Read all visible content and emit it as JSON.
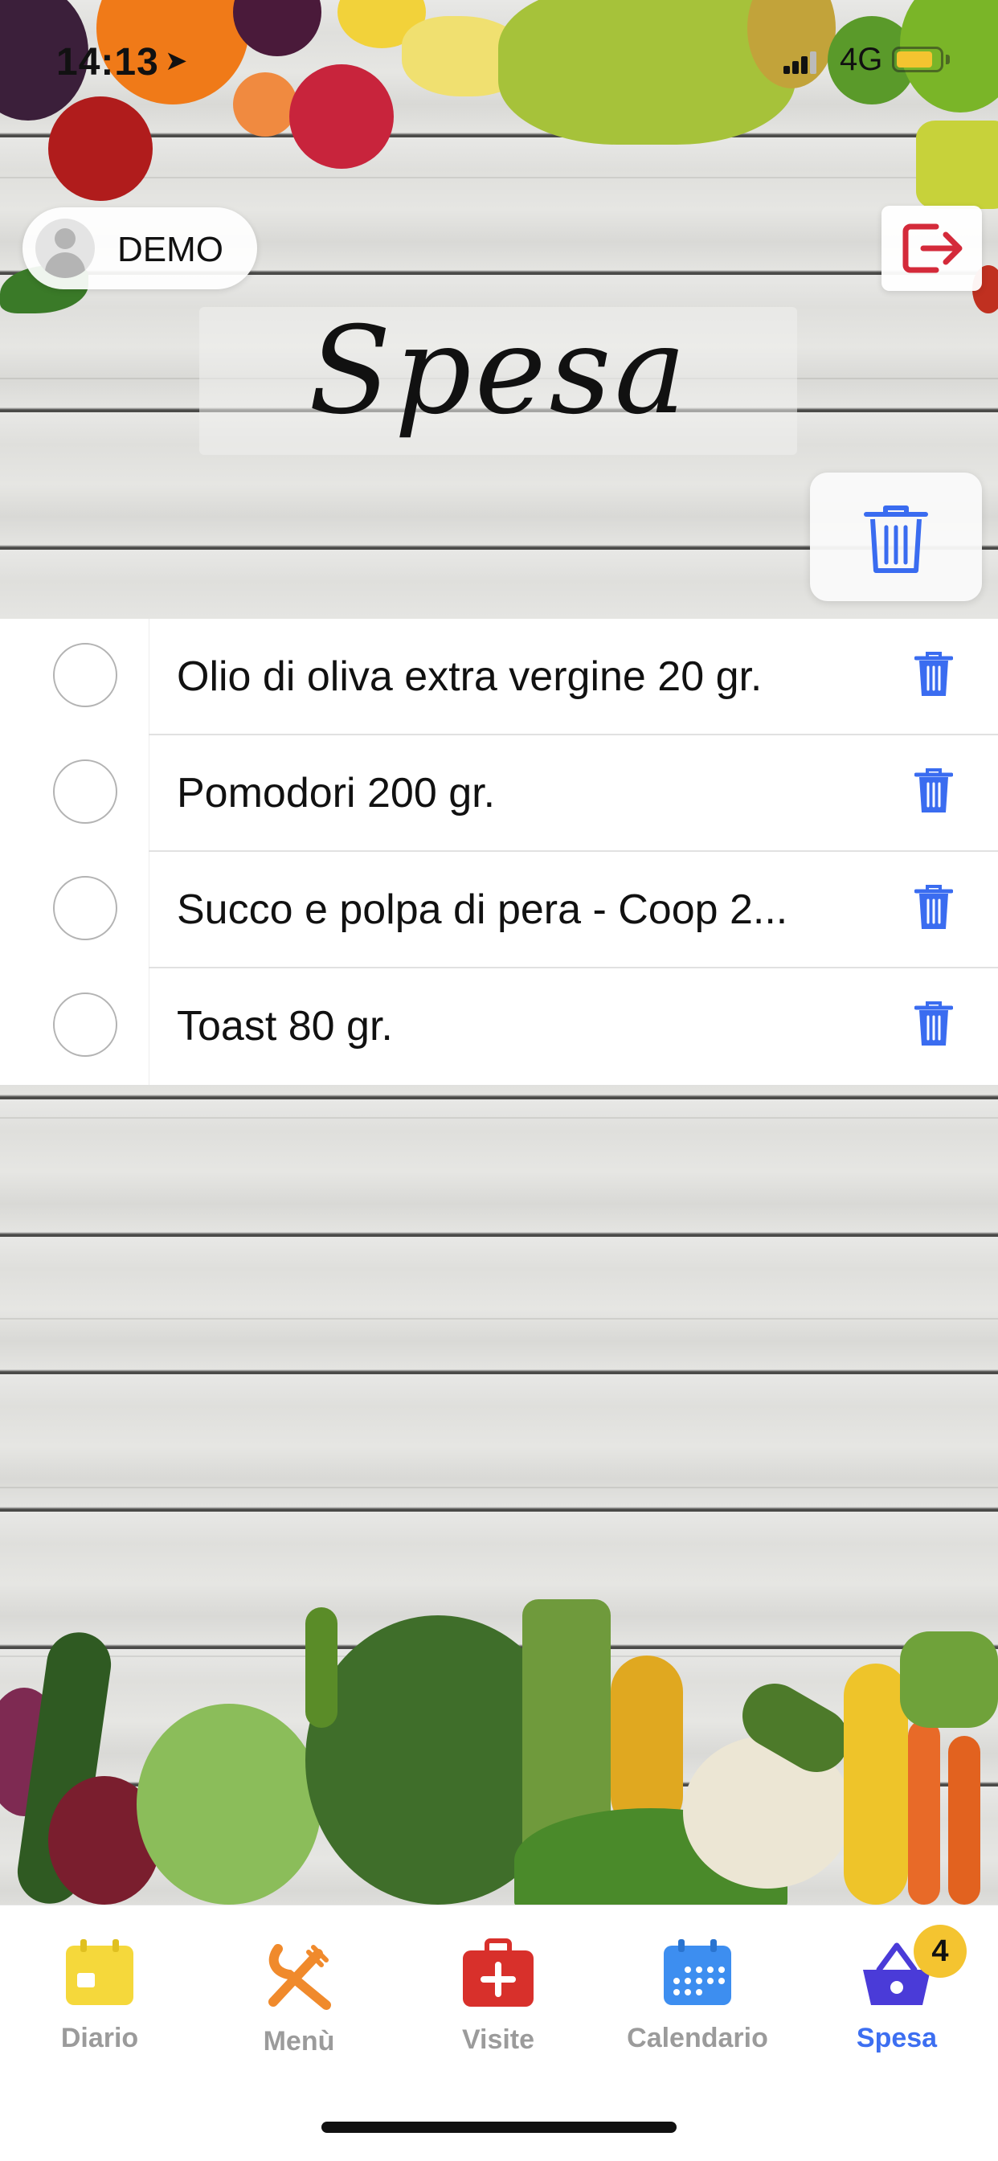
{
  "status_bar": {
    "time": "14:13",
    "network": "4G"
  },
  "header": {
    "user_name": "DEMO",
    "title": "Spesa"
  },
  "shopping_list": {
    "items": [
      {
        "label": "Olio di oliva extra vergine 20 gr.",
        "checked": false
      },
      {
        "label": "Pomodori 200 gr.",
        "checked": false
      },
      {
        "label": "Succo e polpa di pera - Coop 2...",
        "checked": false
      },
      {
        "label": "Toast 80 gr.",
        "checked": false
      }
    ]
  },
  "tabbar": {
    "tabs": [
      {
        "label": "Diario",
        "icon": "calendar-day-icon",
        "color": "#f5d83b"
      },
      {
        "label": "Menù",
        "icon": "fork-knife-icon",
        "color": "#f08a2c"
      },
      {
        "label": "Visite",
        "icon": "medical-case-icon",
        "color": "#d8302b"
      },
      {
        "label": "Calendario",
        "icon": "calendar-grid-icon",
        "color": "#3d8ef0"
      },
      {
        "label": "Spesa",
        "icon": "shopping-basket-icon",
        "color": "#4a3bd8",
        "badge": "4",
        "active": true
      }
    ]
  },
  "colors": {
    "accent": "#3d6ff1",
    "trash_blue": "#3a6cf0",
    "logout_red": "#d42a3a",
    "badge": "#f4c430"
  }
}
